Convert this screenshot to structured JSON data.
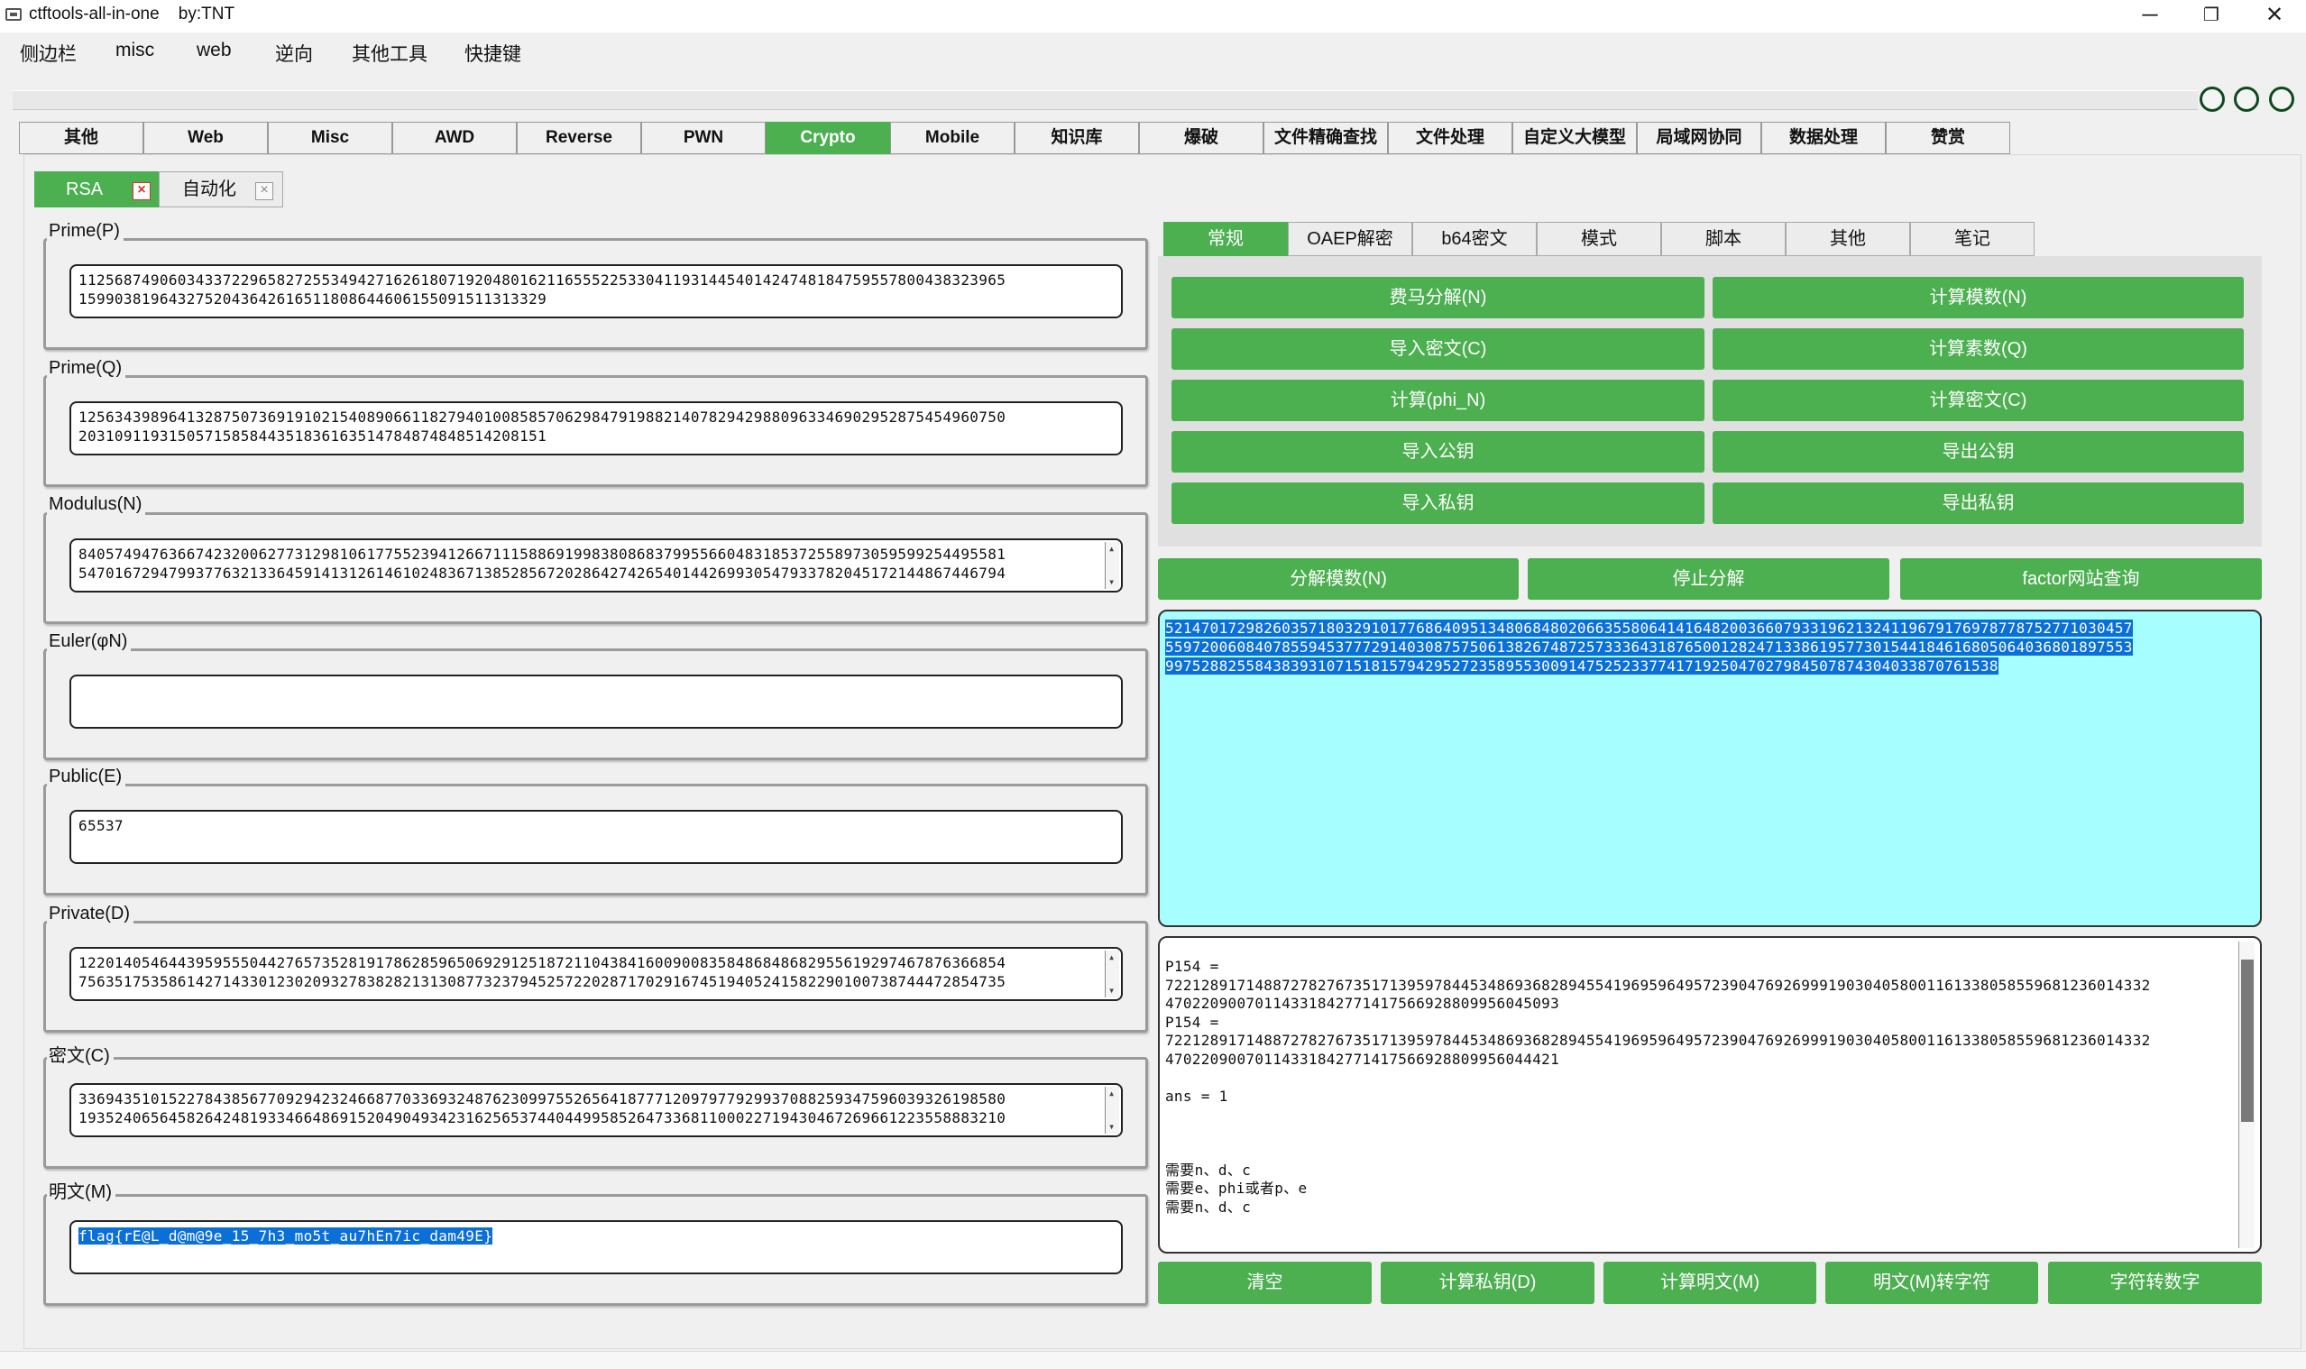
{
  "window": {
    "title": "ctftools-all-in-one    by:TNT",
    "minimize": "─",
    "maximize": "❐",
    "close": "✕"
  },
  "menu": [
    "侧边栏",
    "misc",
    "web",
    "逆向",
    "其他工具",
    "快捷键"
  ],
  "main_tabs": [
    "其他",
    "Web",
    "Misc",
    "AWD",
    "Reverse",
    "PWN",
    "Crypto",
    "Mobile",
    "知识库",
    "爆破",
    "文件精确查找",
    "文件处理",
    "自定义大模型",
    "局域网协同",
    "数据处理",
    "赞赏"
  ],
  "main_tab_active": "Crypto",
  "sub_tabs": [
    {
      "label": "RSA",
      "close": "×"
    },
    {
      "label": "自动化",
      "close": "×"
    }
  ],
  "fields": {
    "p": {
      "label": "Prime(P)",
      "value": "11256874906034337229658272553494271626180719204801621165552253304119314454014247481847595578004383239651599038196432752043642616511808644606155091511313329"
    },
    "q": {
      "label": "Prime(Q)",
      "value": "12563439896413287507369191021540890661182794010085857062984791988214078294298809633469029528754549607502031091193150571585844351836163514784874848514208151"
    },
    "n": {
      "label": "Modulus(N)",
      "value": "84057494763667423200627731298106177552394126671115886919983808683799556604831853725589730595992544955815470167294799377632133645914131261461024836713852856720286427426540144269930547933782045172144867446794"
    },
    "phi": {
      "label": "Euler(φN)",
      "value": ""
    },
    "e": {
      "label": "Public(E)",
      "value": "65537"
    },
    "d": {
      "label": "Private(D)",
      "value": "12201405464439595550442765735281917862859650692912518721104384160090083584868486829556192974678763668547563517535861427143301230209327838282131308773237945257220287170291674519405241582290100738744472854735"
    },
    "c": {
      "label": "密文(C)",
      "value": "33694351015227843856770929423246687703369324876230997552656418777120979779299370882593475960393261985801935240656458264248193346648691520490493423162565374404499585264733681100022719430467269661223558883210"
    },
    "m": {
      "label": "明文(M)",
      "value": "flag{rE@L_d@m@9e_15_7h3_mo5t_au7hEn7ic_dam49E}"
    }
  },
  "right_tabs": [
    "常规",
    "OAEP解密",
    "b64密文",
    "模式",
    "脚本",
    "其他",
    "笔记"
  ],
  "right_tab_active": "常规",
  "ops_grid": [
    [
      "费马分解(N)",
      "计算模数(N)"
    ],
    [
      "导入密文(C)",
      "计算素数(Q)"
    ],
    [
      "计算(phi_N)",
      "计算密文(C)"
    ],
    [
      "导入公钥",
      "导出公钥"
    ],
    [
      "导入私钥",
      "导出私钥"
    ]
  ],
  "factor_buttons": [
    "分解模数(N)",
    "停止分解",
    "factor网站查询"
  ],
  "factor_output": "521470172982603571803291017768640951348068480206635580641416482003660793319621324119679176978778752771030457559720060840785594537772914030875750613826748725733364318765001282471338619577301544184616805064036801897553997528825584383931071518157942952723589553009147525233774171925047027984507874304033870761538",
  "log_lines": [
    "P154 =",
    "7221289171488727827673517139597844534869368289455419695964957239047692699919030405800116133805855968123601433247022090070114331842771417566928809956045093",
    "P154 =",
    "7221289171488727827673517139597844534869368289455419695964957239047692699919030405800116133805855968123601433247022090070114331842771417566928809956044421",
    "",
    "ans = 1",
    "",
    "",
    "",
    "需要n、d、c",
    "需要e、phi或者p、e",
    "需要n、d、c"
  ],
  "bottom_buttons": [
    "清空",
    "计算私钥(D)",
    "计算明文(M)",
    "明文(M)转字符",
    "字符转数字"
  ],
  "colors": {
    "accent": "#4caf50",
    "selection": "#0a6fd6",
    "output_bg": "#a6fefe"
  }
}
